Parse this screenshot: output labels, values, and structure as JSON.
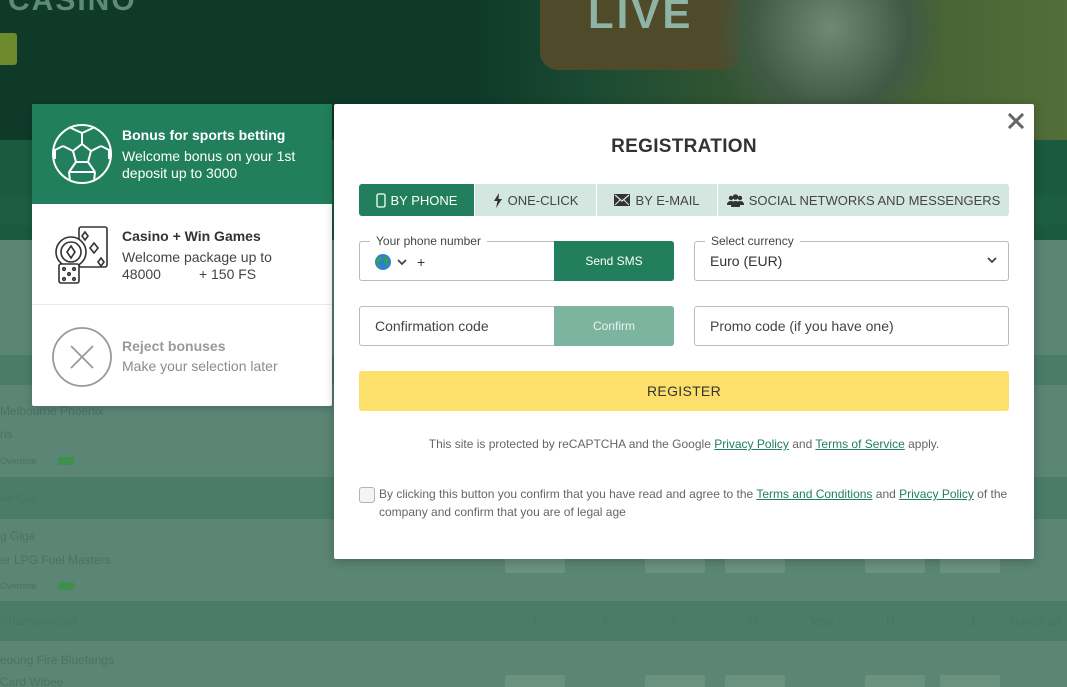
{
  "background": {
    "banner_text": "CASINO",
    "live_label": "LIVE",
    "rows": [
      {
        "label": "Melbourne Phoenix",
        "kind": "team"
      },
      {
        "label": "ns",
        "kind": "team"
      },
      {
        "label": "Overtime",
        "kind": "meta"
      },
      {
        "label": "ue Cup",
        "kind": "league"
      },
      {
        "label": "g Giga",
        "kind": "team"
      },
      {
        "label": "er LPG Fuel Masters",
        "kind": "team"
      },
      {
        "label": "Overtime",
        "kind": "meta"
      },
      {
        "label": "Championship",
        "kind": "league"
      },
      {
        "label": "eoung Fire Bluefangs",
        "kind": "team"
      },
      {
        "label": "Card Wibee",
        "kind": "team"
      }
    ],
    "league_header_cols": [
      "1",
      "X",
      "2",
      "O",
      "Total",
      "U",
      "1",
      "Handicap"
    ]
  },
  "bonus_panel": {
    "items": [
      {
        "title": "Bonus for sports betting",
        "description": "Welcome bonus on your 1st deposit up to 3000",
        "icon": "soccer-ball-icon",
        "selected": true
      },
      {
        "title": "Casino + Win Games",
        "description_line1": "Welcome package up to",
        "amount": "48000",
        "free_spins": "+ 150 FS",
        "icon": "casino-chips-cards-icon",
        "selected": false
      },
      {
        "title": "Reject bonuses",
        "description": "Make your selection later",
        "icon": "reject-x-icon",
        "selected": false
      }
    ]
  },
  "registration": {
    "title": "REGISTRATION",
    "close_icon": "close-icon",
    "tabs": [
      {
        "label": "BY PHONE",
        "icon": "phone-icon",
        "active": true
      },
      {
        "label": "ONE-CLICK",
        "icon": "lightning-icon",
        "active": false
      },
      {
        "label": "BY E-MAIL",
        "icon": "envelope-icon",
        "active": false
      },
      {
        "label": "SOCIAL NETWORKS AND MESSENGERS",
        "icon": "users-icon",
        "active": false
      }
    ],
    "phone": {
      "legend": "Your phone number",
      "country_icon": "globe-icon",
      "prefix": "+",
      "value": "",
      "send_button": "Send SMS"
    },
    "currency": {
      "legend": "Select currency",
      "selected": "Euro (EUR)"
    },
    "confirmation": {
      "placeholder": "Confirmation code",
      "value": "",
      "button": "Confirm"
    },
    "promo": {
      "placeholder": "Promo code (if you have one)",
      "value": ""
    },
    "register_button": "REGISTER",
    "recaptcha": {
      "prefix": "This site is protected by reCAPTCHA and the Google",
      "privacy_link": "Privacy Policy",
      "and": "and",
      "terms_link": "Terms of Service",
      "suffix": "apply."
    },
    "agreement": {
      "checked": false,
      "prefix": "By clicking this button you confirm that you have read and agree to the",
      "terms_link": "Terms and Conditions",
      "and": "and",
      "privacy_link": "Privacy Policy",
      "suffix": "of the company and confirm that you are of legal age"
    }
  },
  "colors": {
    "brand_green": "#217f5d",
    "tab_bg": "#d3e6e0",
    "confirm_disabled": "#7cb4a0",
    "register_yellow": "#fddf6b",
    "link": "#217f5d"
  }
}
